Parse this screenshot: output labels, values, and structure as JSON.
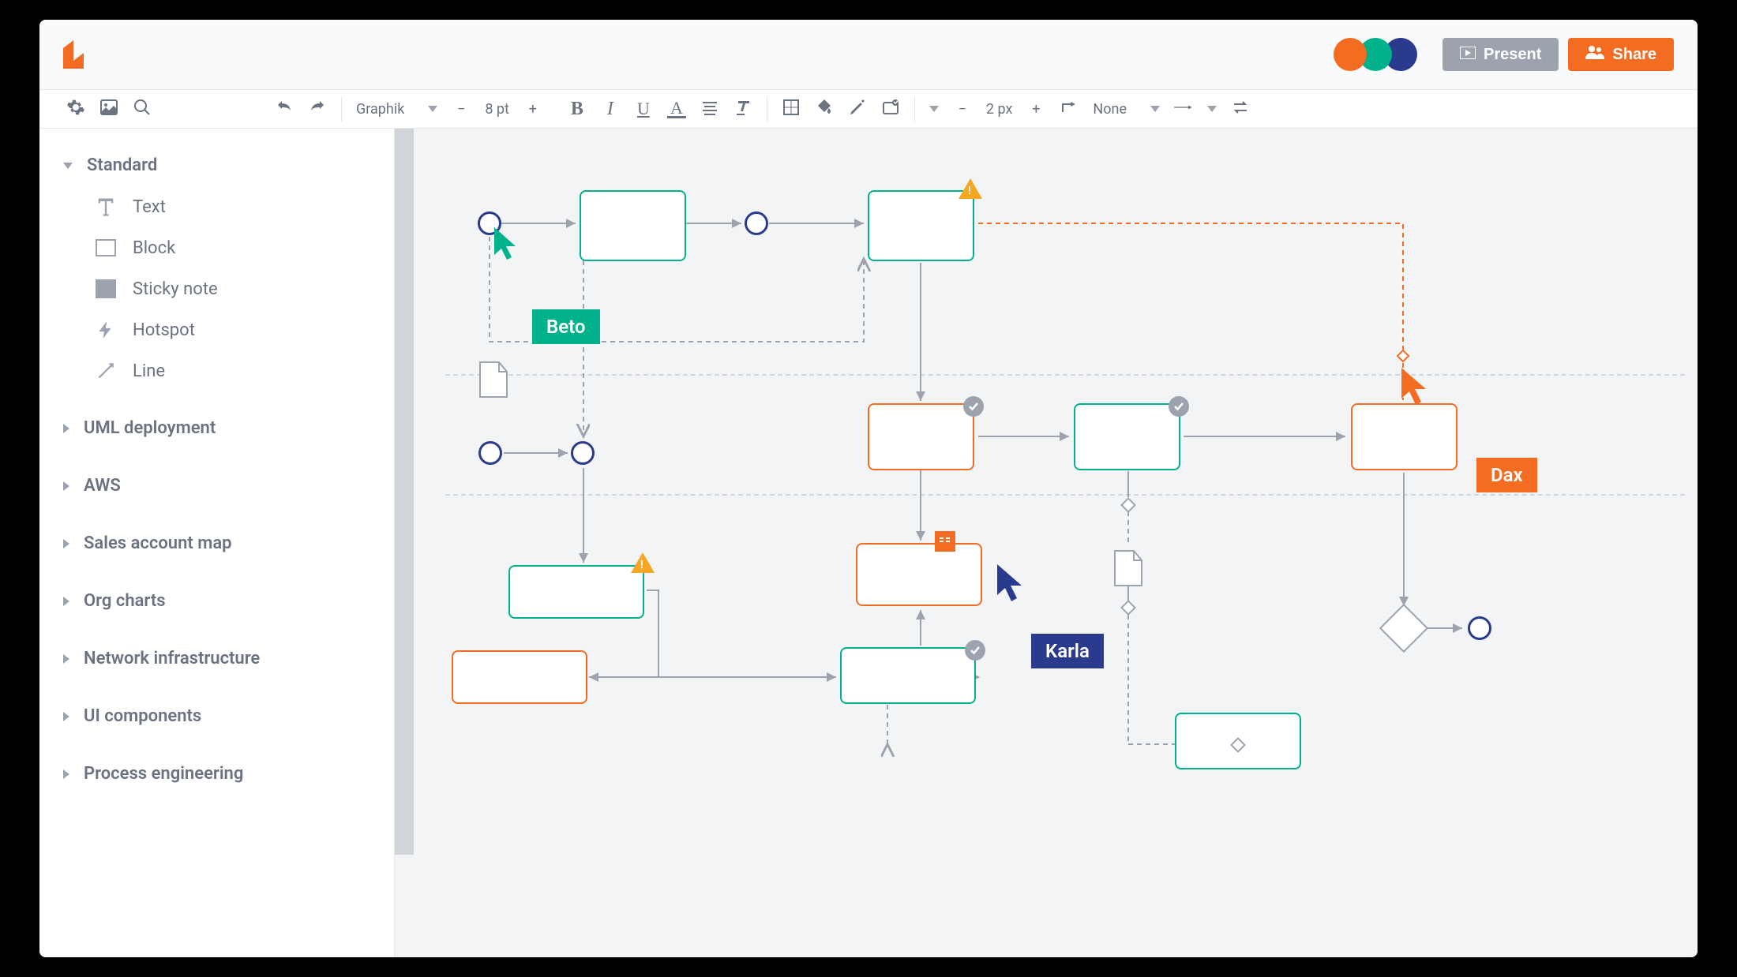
{
  "header": {
    "present_label": "Present",
    "share_label": "Share"
  },
  "toolbar": {
    "font_name": "Graphik",
    "font_size": "8 pt",
    "stroke_width": "2 px",
    "line_style": "None"
  },
  "sidebar": {
    "sections": [
      {
        "title": "Standard",
        "expanded": true
      },
      {
        "title": "UML deployment",
        "expanded": false
      },
      {
        "title": "AWS",
        "expanded": false
      },
      {
        "title": "Sales account map",
        "expanded": false
      },
      {
        "title": "Org charts",
        "expanded": false
      },
      {
        "title": "Network infrastructure",
        "expanded": false
      },
      {
        "title": "UI components",
        "expanded": false
      },
      {
        "title": "Process engineering",
        "expanded": false
      }
    ],
    "standard_items": [
      {
        "label": "Text"
      },
      {
        "label": "Block"
      },
      {
        "label": "Sticky note"
      },
      {
        "label": "Hotspot"
      },
      {
        "label": "Line"
      }
    ]
  },
  "collaborators": {
    "beto": "Beto",
    "karla": "Karla",
    "dax": "Dax"
  }
}
